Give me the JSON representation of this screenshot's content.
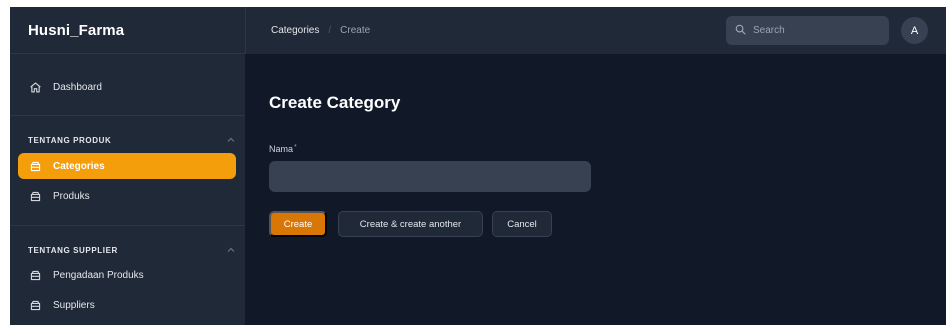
{
  "app": {
    "brand": "Husni_Farma"
  },
  "sidebar": {
    "dashboard": {
      "label": "Dashboard",
      "icon": "home-icon"
    },
    "groups": [
      {
        "label": "TENTANG PRODUK",
        "items": [
          {
            "label": "Categories",
            "icon": "folder-icon",
            "active": true
          },
          {
            "label": "Produks",
            "icon": "folder-icon",
            "active": false
          }
        ]
      },
      {
        "label": "TENTANG SUPPLIER",
        "items": [
          {
            "label": "Pengadaan Produks",
            "icon": "folder-icon",
            "active": false
          },
          {
            "label": "Suppliers",
            "icon": "folder-icon",
            "active": false
          }
        ]
      }
    ]
  },
  "topbar": {
    "breadcrumbs": [
      "Categories",
      "Create"
    ],
    "search": {
      "placeholder": "Search",
      "value": ""
    },
    "avatar_initial": "A"
  },
  "main": {
    "title": "Create Category",
    "form": {
      "name_label": "Nama",
      "required_mark": "*",
      "name_value": ""
    },
    "buttons": {
      "create": "Create",
      "create_another": "Create & create another",
      "cancel": "Cancel"
    }
  },
  "colors": {
    "accent": "#f59e0b",
    "primary_button": "#d97706",
    "background": "#111827",
    "sidebar": "#1f2937",
    "input": "#374151"
  }
}
